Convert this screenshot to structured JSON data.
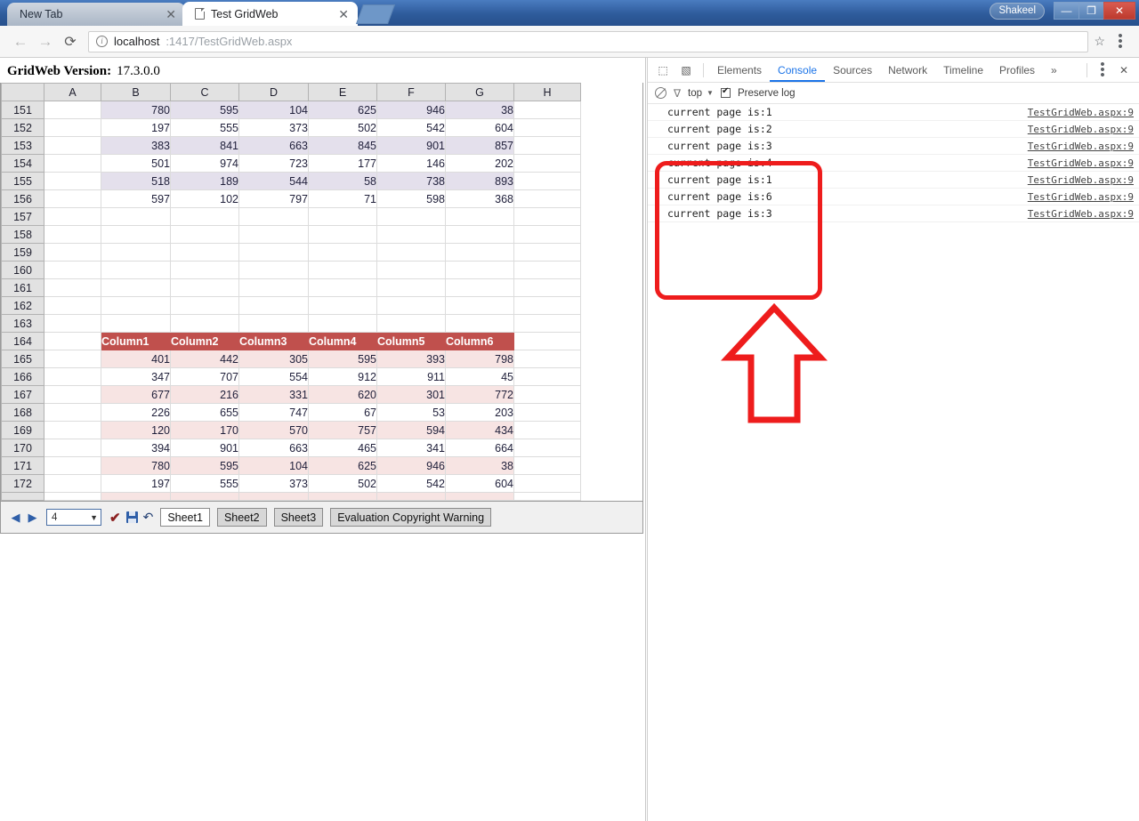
{
  "browser": {
    "tabs": [
      {
        "title": "New Tab",
        "active": false,
        "close_label": "✕"
      },
      {
        "title": "Test GridWeb",
        "active": true,
        "close_label": "✕"
      }
    ],
    "newtab_icon": "new-tab-icon",
    "nav": {
      "back_icon": "←",
      "forward_icon": "→",
      "reload_icon": "⟳",
      "info_icon": "i",
      "star_icon": "☆",
      "menu_icon": "menu"
    },
    "address": {
      "host": "localhost",
      "path": ":1417/TestGridWeb.aspx"
    },
    "window": {
      "user": "Shakeel",
      "minimize": "—",
      "maximize": "❐",
      "close": "✕"
    }
  },
  "gridweb": {
    "title_label": "GridWeb Version:",
    "version": "17.3.0.0",
    "columns": [
      "A",
      "B",
      "C",
      "D",
      "E",
      "F",
      "G",
      "H"
    ],
    "table1_rows": [
      {
        "n": "151",
        "v": [
          "780",
          "595",
          "104",
          "625",
          "946",
          "38"
        ]
      },
      {
        "n": "152",
        "v": [
          "197",
          "555",
          "373",
          "502",
          "542",
          "604"
        ]
      },
      {
        "n": "153",
        "v": [
          "383",
          "841",
          "663",
          "845",
          "901",
          "857"
        ]
      },
      {
        "n": "154",
        "v": [
          "501",
          "974",
          "723",
          "177",
          "146",
          "202"
        ]
      },
      {
        "n": "155",
        "v": [
          "518",
          "189",
          "544",
          "58",
          "738",
          "893"
        ]
      },
      {
        "n": "156",
        "v": [
          "597",
          "102",
          "797",
          "71",
          "598",
          "368"
        ]
      }
    ],
    "empty_rows": [
      "157",
      "158",
      "159",
      "160",
      "161",
      "162",
      "163"
    ],
    "table2_header_row": "164",
    "table2_headers": [
      "Column1",
      "Column2",
      "Column3",
      "Column4",
      "Column5",
      "Column6"
    ],
    "table2_rows": [
      {
        "n": "165",
        "v": [
          "401",
          "442",
          "305",
          "595",
          "393",
          "798"
        ]
      },
      {
        "n": "166",
        "v": [
          "347",
          "707",
          "554",
          "912",
          "911",
          "45"
        ]
      },
      {
        "n": "167",
        "v": [
          "677",
          "216",
          "331",
          "620",
          "301",
          "772"
        ]
      },
      {
        "n": "168",
        "v": [
          "226",
          "655",
          "747",
          "67",
          "53",
          "203"
        ]
      },
      {
        "n": "169",
        "v": [
          "120",
          "170",
          "570",
          "757",
          "594",
          "434"
        ]
      },
      {
        "n": "170",
        "v": [
          "394",
          "901",
          "663",
          "465",
          "341",
          "664"
        ]
      },
      {
        "n": "171",
        "v": [
          "780",
          "595",
          "104",
          "625",
          "946",
          "38"
        ]
      },
      {
        "n": "172",
        "v": [
          "197",
          "555",
          "373",
          "502",
          "542",
          "604"
        ]
      }
    ],
    "colors": {
      "band_purple": "#e4e0ec",
      "band_pink": "#f7e4e3",
      "header_red": "#c0504d",
      "header_grey": "#e2e2e2"
    },
    "toolbar": {
      "prev_icon": "◀",
      "next_icon": "▶",
      "page_value": "4",
      "page_caret": "▼",
      "confirm_icon": "✔",
      "save_icon": "save-icon",
      "undo_icon": "↶",
      "sheets": [
        {
          "label": "Sheet1",
          "active": true
        },
        {
          "label": "Sheet2",
          "active": false
        },
        {
          "label": "Sheet3",
          "active": false
        },
        {
          "label": "Evaluation Copyright Warning",
          "active": false
        }
      ]
    }
  },
  "devtools": {
    "inspect_icon": "⬚",
    "device_icon": "▧",
    "tabs": [
      {
        "label": "Elements",
        "active": false
      },
      {
        "label": "Console",
        "active": true
      },
      {
        "label": "Sources",
        "active": false
      },
      {
        "label": "Network",
        "active": false
      },
      {
        "label": "Timeline",
        "active": false
      },
      {
        "label": "Profiles",
        "active": false
      }
    ],
    "overflow_icon": "»",
    "more_icon": "more-vertical-icon",
    "close_icon": "✕",
    "filterbar": {
      "clear_icon": "clear-console-icon",
      "filter_icon": "∇",
      "context": "top",
      "context_caret": "▼",
      "preserve_log_label": "Preserve log",
      "preserve_log_checked": true
    },
    "messages": [
      {
        "text": "current page is:1",
        "source": "TestGridWeb.aspx:9"
      },
      {
        "text": "current page is:2",
        "source": "TestGridWeb.aspx:9"
      },
      {
        "text": "current page is:3",
        "source": "TestGridWeb.aspx:9"
      },
      {
        "text": "current page is:4",
        "source": "TestGridWeb.aspx:9"
      },
      {
        "text": "current page is:1",
        "source": "TestGridWeb.aspx:9"
      },
      {
        "text": "current page is:6",
        "source": "TestGridWeb.aspx:9"
      },
      {
        "text": "current page is:3",
        "source": "TestGridWeb.aspx:9"
      }
    ]
  },
  "annotation": {
    "color": "#ee1c1c",
    "shape": "rounded-box-with-up-arrow"
  }
}
